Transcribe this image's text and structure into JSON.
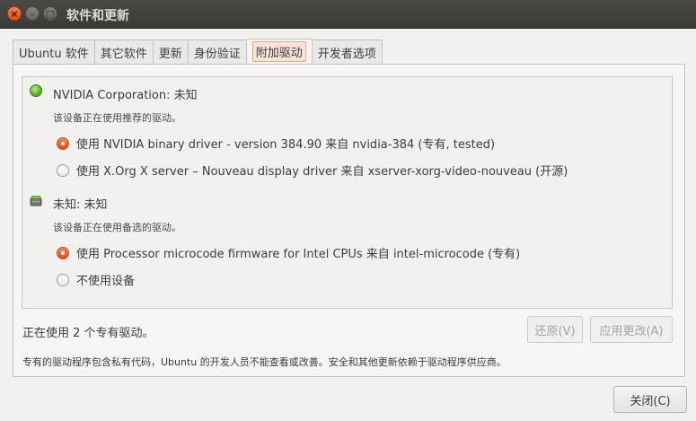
{
  "window": {
    "title": "软件和更新",
    "close_glyph": "×",
    "min_glyph": "–",
    "max_glyph": "□"
  },
  "tabs": [
    {
      "label": "Ubuntu 软件"
    },
    {
      "label": "其它软件"
    },
    {
      "label": "更新"
    },
    {
      "label": "身份验证"
    },
    {
      "label": "附加驱动",
      "active": true
    },
    {
      "label": "开发者选项"
    }
  ],
  "devices": [
    {
      "title": "NVIDIA Corporation: 未知",
      "subtitle": "该设备正在使用推荐的驱动。",
      "icon": "green-status-icon",
      "options": [
        {
          "label": "使用 NVIDIA binary driver - version 384.90 来自 nvidia-384 (专有, tested)",
          "selected": true
        },
        {
          "label": "使用 X.Org X server – Nouveau display driver 来自 xserver-xorg-video-nouveau (开源)",
          "selected": false
        }
      ]
    },
    {
      "title": "未知: 未知",
      "subtitle": "该设备正在使用备选的驱动。",
      "icon": "chip-icon",
      "options": [
        {
          "label": "使用 Processor microcode firmware for Intel CPUs 来自 intel-microcode (专有)",
          "selected": true
        },
        {
          "label": "不使用设备",
          "selected": false
        }
      ]
    }
  ],
  "status": "正在使用 2 个专有驱动。",
  "buttons": {
    "revert": "还原(V)",
    "apply": "应用更改(A)",
    "close": "关闭(C)"
  },
  "note": "专有的驱动程序包含私有代码，Ubuntu 的开发人员不能查看或改善。安全和其他更新依赖于驱动程序供应商。",
  "colors": {
    "accent": "#dd4814",
    "titlebar": "#3c3b37",
    "status_green": "#5ab026"
  }
}
